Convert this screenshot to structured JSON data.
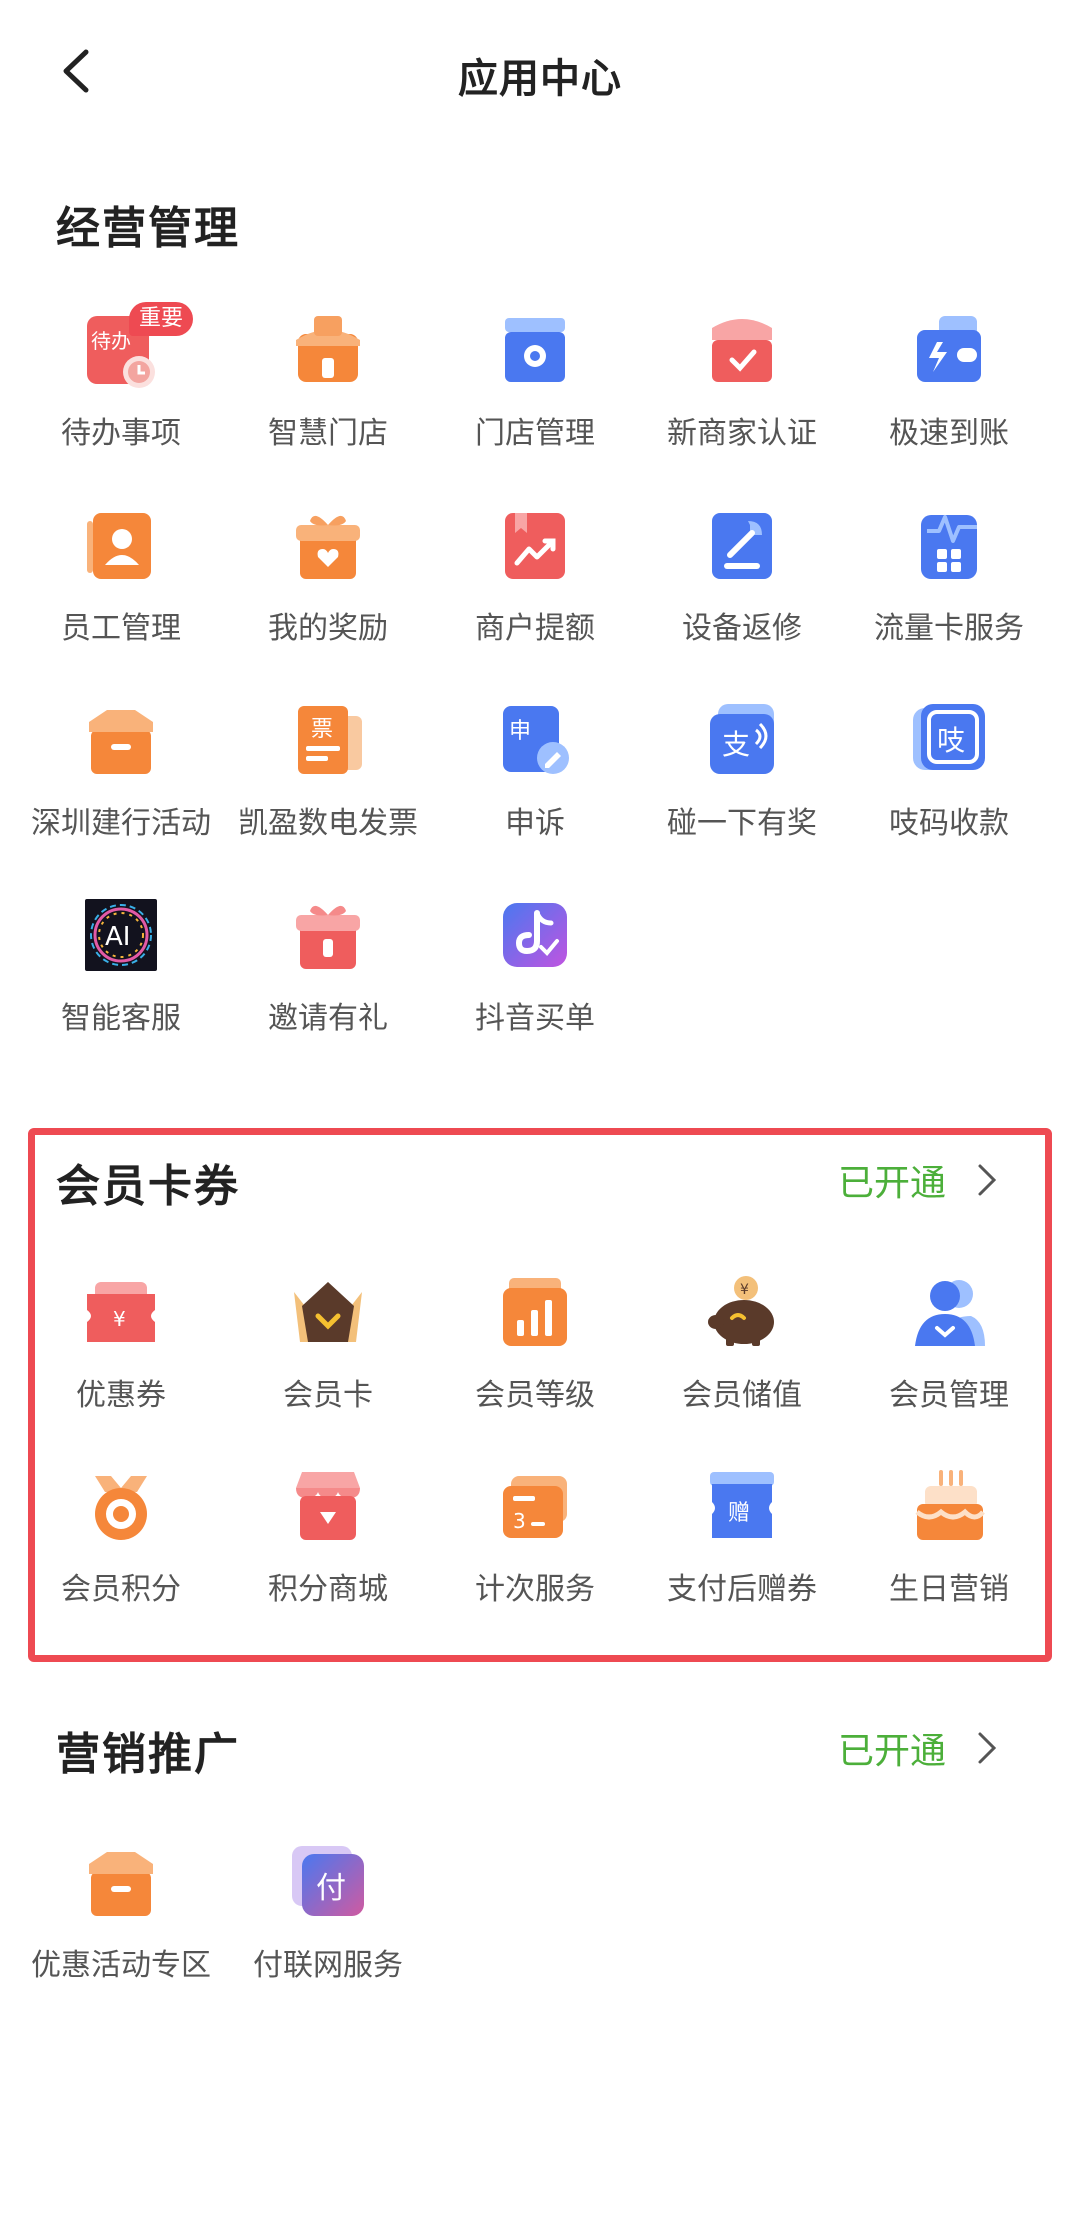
{
  "header": {
    "title": "应用中心",
    "back_icon": "chevron-left-icon"
  },
  "sections": [
    {
      "title": "经营管理",
      "status": "",
      "items": [
        {
          "label": "待办事项",
          "icon": "todo-icon",
          "badge": "重要"
        },
        {
          "label": "智慧门店",
          "icon": "smart-store-icon"
        },
        {
          "label": "门店管理",
          "icon": "store-manage-icon"
        },
        {
          "label": "新商家认证",
          "icon": "merchant-verify-icon"
        },
        {
          "label": "极速到账",
          "icon": "fast-wallet-icon"
        },
        {
          "label": "员工管理",
          "icon": "staff-icon"
        },
        {
          "label": "我的奖励",
          "icon": "reward-gift-icon"
        },
        {
          "label": "商户提额",
          "icon": "limit-raise-icon"
        },
        {
          "label": "设备返修",
          "icon": "repair-wrench-icon"
        },
        {
          "label": "流量卡服务",
          "icon": "data-card-icon"
        },
        {
          "label": "深圳建行活动",
          "icon": "activity-box-icon"
        },
        {
          "label": "凯盈数电发票",
          "icon": "invoice-ticket-icon"
        },
        {
          "label": "申诉",
          "icon": "appeal-icon"
        },
        {
          "label": "碰一下有奖",
          "icon": "tap-pay-icon"
        },
        {
          "label": "吱码收款",
          "icon": "zhi-code-icon"
        },
        {
          "label": "智能客服",
          "icon": "ai-service-icon"
        },
        {
          "label": "邀请有礼",
          "icon": "invite-gift-icon"
        },
        {
          "label": "抖音买单",
          "icon": "douyin-pay-icon"
        }
      ]
    },
    {
      "title": "会员卡券",
      "status": "已开通",
      "items": [
        {
          "label": "优惠券",
          "icon": "coupon-icon"
        },
        {
          "label": "会员卡",
          "icon": "crown-icon"
        },
        {
          "label": "会员等级",
          "icon": "level-chart-icon"
        },
        {
          "label": "会员储值",
          "icon": "piggy-bank-icon"
        },
        {
          "label": "会员管理",
          "icon": "member-user-icon"
        },
        {
          "label": "会员积分",
          "icon": "points-icon"
        },
        {
          "label": "积分商城",
          "icon": "points-mall-icon"
        },
        {
          "label": "计次服务",
          "icon": "count-card-icon"
        },
        {
          "label": "支付后赠券",
          "icon": "gift-voucher-icon"
        },
        {
          "label": "生日营销",
          "icon": "birthday-cake-icon"
        }
      ]
    },
    {
      "title": "营销推广",
      "status": "已开通",
      "items": [
        {
          "label": "优惠活动专区",
          "icon": "promo-box-icon"
        },
        {
          "label": "付联网服务",
          "icon": "fulian-icon"
        }
      ]
    }
  ],
  "icon_text": {
    "todo": "待办",
    "invoice": "票",
    "appeal": "申",
    "tap": "支",
    "zhi": "吱",
    "ai": "AI",
    "voucher": "赠",
    "fulian": "付",
    "count": "3"
  },
  "colors": {
    "accent_green": "#4caf3a",
    "highlight_red": "#ee4a52",
    "orange": "#f5873a",
    "blue": "#4a78f0",
    "red": "#ef5d5d"
  }
}
